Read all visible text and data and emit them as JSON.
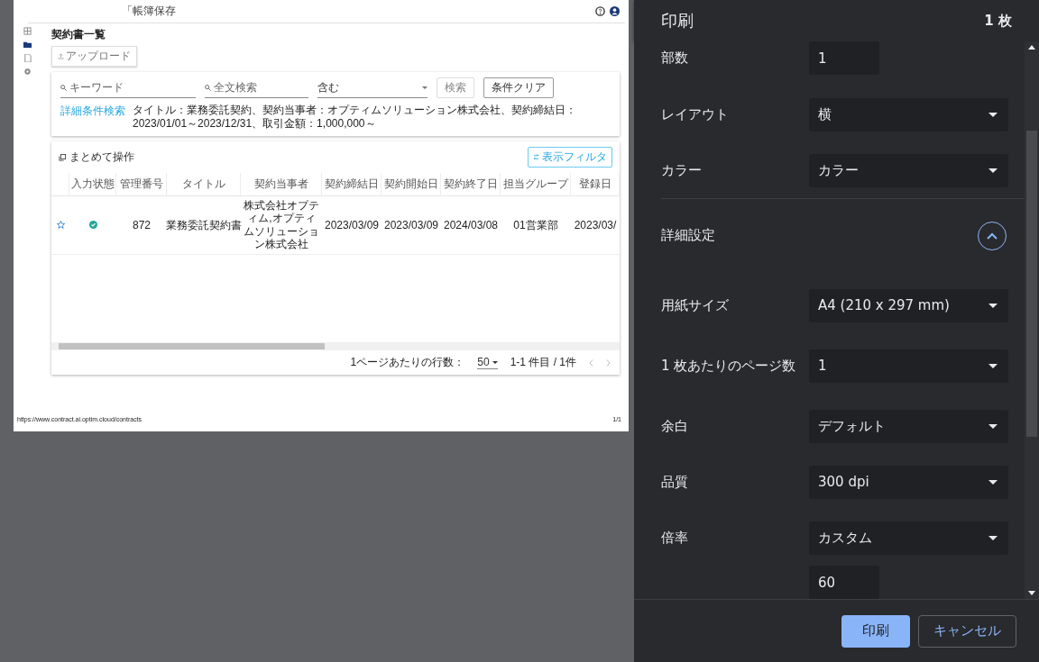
{
  "preview": {
    "app_title": "「帳簿保存",
    "sidebar": [
      {
        "kind": "dashboard",
        "selected": false
      },
      {
        "kind": "folder",
        "selected": true
      },
      {
        "kind": "document",
        "selected": false
      },
      {
        "kind": "settings",
        "selected": false
      }
    ],
    "page_title": "契約書一覧",
    "upload_button": "アップロード",
    "search": {
      "keyword_placeholder": "キーワード",
      "fulltext_placeholder": "全文検索",
      "match_value": "含む",
      "search_button": "検索",
      "clear_button": "条件クリア",
      "advanced_link": "詳細条件検索",
      "summary": "タイトル：業務委託契約、契約当事者：オプティムソリューション株式会社、契約締結日：2023/01/01～2023/12/31、取引金額：1,000,000～"
    },
    "bulk_action": "まとめて操作",
    "filter_button": "表示フィルタ",
    "table": {
      "columns": [
        "",
        "入力状態",
        "管理番号",
        "タイトル",
        "契約当事者",
        "契約締結日",
        "契約開始日",
        "契約終了日",
        "担当グループ",
        "登録日"
      ],
      "rows": [
        {
          "cells": [
            {
              "kind": "star",
              "starred": false
            },
            {
              "kind": "status",
              "complete": true
            },
            "872",
            "業務委託契約書",
            "株式会社オプティム,オプティムソリューション株式会社",
            "2023/03/09",
            "2023/03/09",
            "2024/03/08",
            "01営業部",
            "2023/03/"
          ]
        }
      ]
    },
    "pagination": {
      "rows_label": "1ページあたりの行数：",
      "rows_value": "50",
      "range": "1-1 件目 / 1件"
    },
    "footer_url": "https://www.contract.ai.optim.cloud/contracts",
    "footer_page": "1/1"
  },
  "print": {
    "title": "印刷",
    "sheets": "1 枚",
    "settings": [
      {
        "kind": "input",
        "label": "部数",
        "value": "1"
      },
      {
        "kind": "select",
        "label": "レイアウト",
        "value": "横"
      },
      {
        "kind": "select",
        "label": "カラー",
        "value": "カラー"
      },
      {
        "kind": "section",
        "label": "詳細設定",
        "expanded": true
      },
      {
        "kind": "select",
        "label": "用紙サイズ",
        "value": "A4 (210 x 297 mm)"
      },
      {
        "kind": "select",
        "label": "1 枚あたりのページ数",
        "value": "1"
      },
      {
        "kind": "select",
        "label": "余白",
        "value": "デフォルト"
      },
      {
        "kind": "select",
        "label": "品質",
        "value": "300 dpi"
      },
      {
        "kind": "select",
        "label": "倍率",
        "value": "カスタム"
      },
      {
        "kind": "input",
        "value": "60"
      }
    ],
    "print_button": "印刷",
    "cancel_button": "キャンセル"
  }
}
